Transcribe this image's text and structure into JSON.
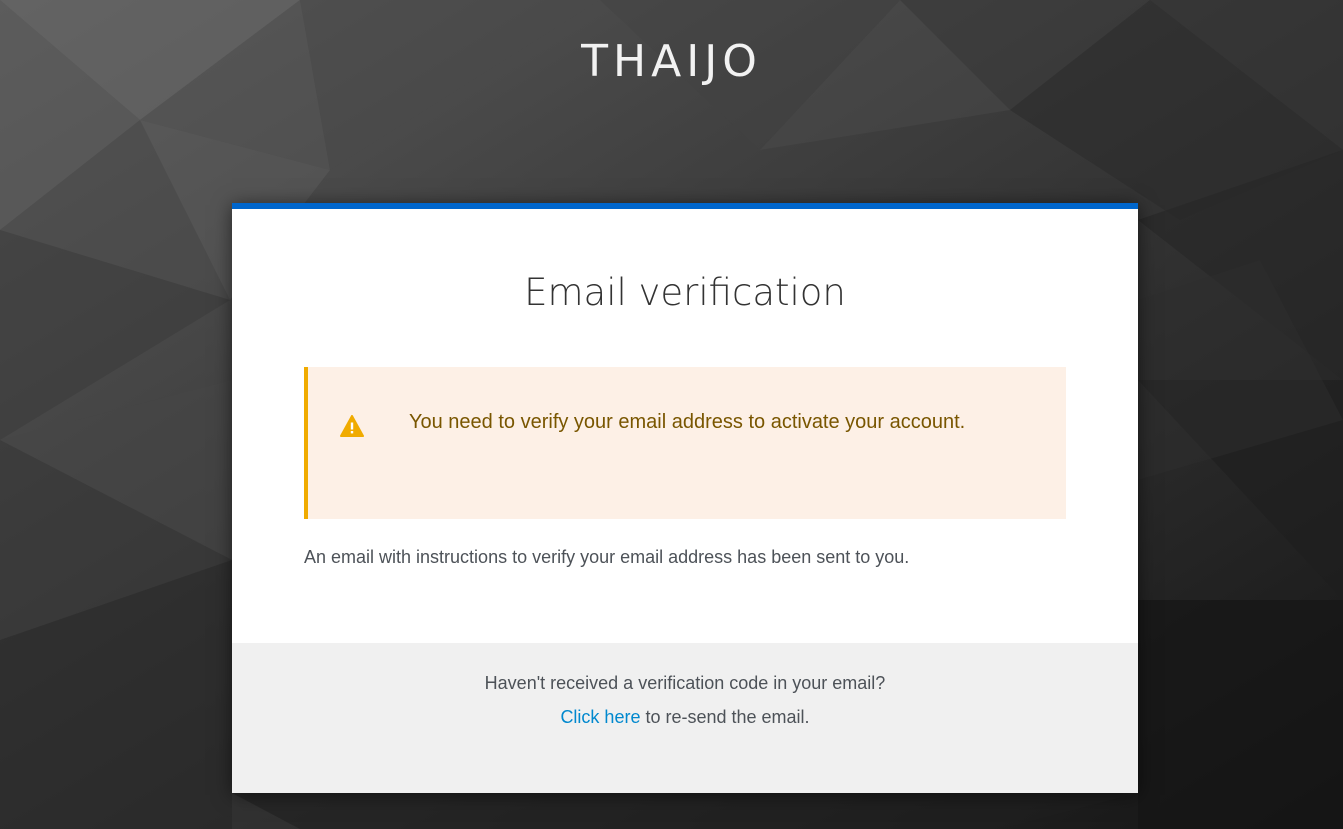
{
  "brand": {
    "title": "THAIJO"
  },
  "card": {
    "title": "Email verification",
    "accent_color": "#0066cc"
  },
  "alert": {
    "type": "warning",
    "icon": "warning-triangle-icon",
    "message": "You need to verify your email address to activate your account.",
    "border_color": "#f0ab00",
    "background_color": "#fdf0e6"
  },
  "info": {
    "text": "An email with instructions to verify your email address has been sent to you."
  },
  "footer": {
    "question": "Haven't received a verification code in your email?",
    "link_label": "Click here",
    "link_suffix": " to re-send the email."
  }
}
